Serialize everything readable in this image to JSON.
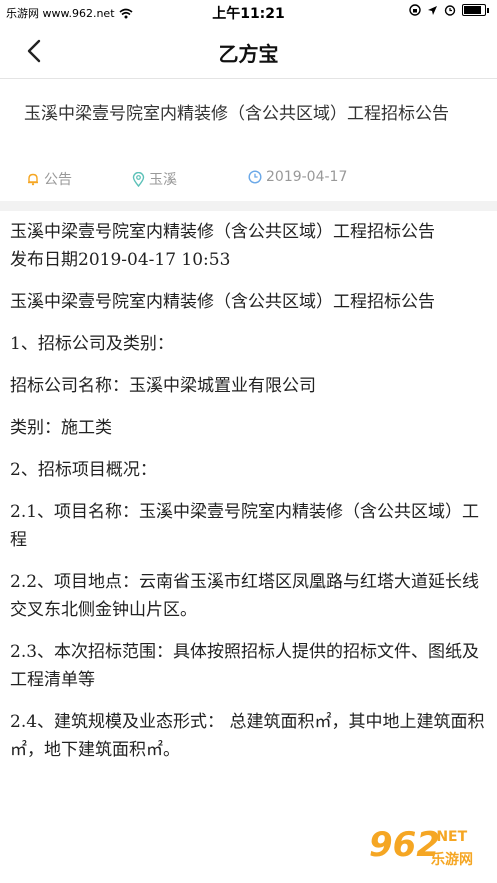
{
  "status_bar": {
    "carrier": "乐游网 www.962.net",
    "time": "上午11:21"
  },
  "nav": {
    "title": "乙方宝"
  },
  "article": {
    "title": "玉溪中梁壹号院室内精装修（含公共区域）工程招标公告",
    "meta": {
      "category": "公告",
      "location": "玉溪",
      "date": "2019-04-17"
    }
  },
  "content": {
    "paragraphs": [
      "玉溪中梁壹号院室内精装修（含公共区域）工程招标公告",
      "发布日期2019-04-17 10:53",
      "玉溪中梁壹号院室内精装修（含公共区域）工程招标公告",
      "1、招标公司及类别：",
      "招标公司名称：玉溪中梁城置业有限公司",
      "类别：施工类",
      "2、招标项目概况：",
      "2.1、项目名称：玉溪中梁壹号院室内精装修（含公共区域）工程",
      "2.2、项目地点：云南省玉溪市红塔区凤凰路与红塔大道延长线交叉东北侧金钟山片区。",
      "2.3、本次招标范围：具体按照招标人提供的招标文件、图纸及工程清单等",
      "2.4、建筑规模及业态形式： 总建筑面积㎡，其中地上建筑面积㎡，地下建筑面积㎡。"
    ]
  },
  "watermark": {
    "number": "962",
    "net": ".NET",
    "site": "乐游网"
  },
  "colors": {
    "accent_orange": "#f5a623",
    "meta_location": "#5cc1b8",
    "meta_date": "#6aa8e8"
  }
}
